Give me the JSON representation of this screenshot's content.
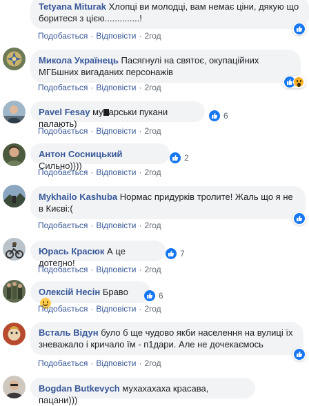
{
  "action_labels": {
    "like": "Подобається",
    "reply": "Відповісти",
    "sep": "·"
  },
  "comments": [
    {
      "name": "Tetyana Miturak",
      "text": "Хлопці ви молодці, вам немає ціни, дякую що боритеся з цією..............!",
      "time": "2год",
      "reactions_count": ""
    },
    {
      "name": "Микола Українець",
      "text": "Пасягнулі на святоє, окупаційних МГБшних вигаданих персонажів",
      "time": "2год",
      "reactions_count": ""
    },
    {
      "name": "Pavel Fesay",
      "text_before": "му",
      "text_after": "арськи пукани палають)",
      "time": "2год",
      "reactions_count": "6"
    },
    {
      "name": "Антон Сосницький",
      "text": "Сильно))))",
      "time": "2год",
      "reactions_count": "2"
    },
    {
      "name": "Mykhailo Kashuba",
      "text": "Нормас придурків тролите! Жаль що я не в Києві:(",
      "time": "2год",
      "reactions_count": ""
    },
    {
      "name": "Юрась Красюк",
      "text": "А це дотепно!",
      "time": "2год",
      "reactions_count": "7"
    },
    {
      "name": "Олексій Несін",
      "text": "Браво",
      "time": "2год",
      "reactions_count": "6"
    },
    {
      "name": "Всталь Відун",
      "text": "було б ще чудово якби населення на вулиці їх зневажало і кричало їм - п1дари. Але не дочекаємось",
      "time": "2год",
      "reactions_count": ""
    },
    {
      "name": "Bogdan Butkevych",
      "text": "мухахахаха красава, пацани)))",
      "time": "",
      "reactions_count": ""
    }
  ]
}
